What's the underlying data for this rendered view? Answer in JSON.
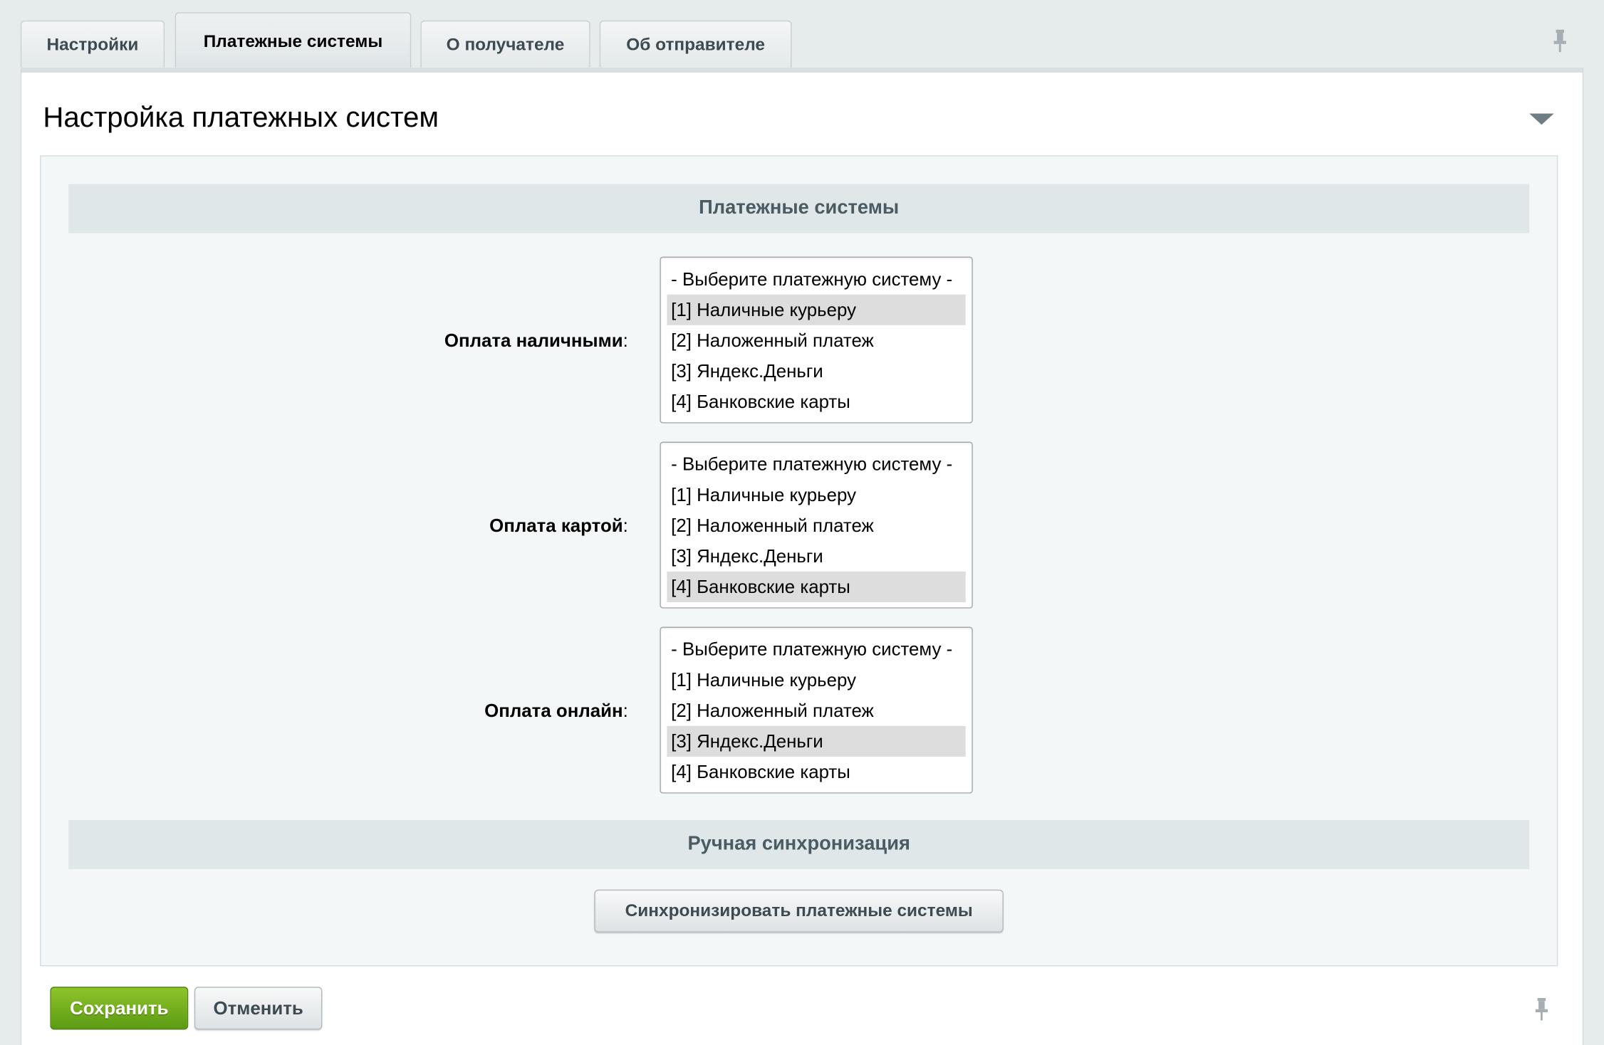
{
  "tabs": [
    {
      "label": "Настройки",
      "active": false
    },
    {
      "label": "Платежные системы",
      "active": true
    },
    {
      "label": "О получателе",
      "active": false
    },
    {
      "label": "Об отправителе",
      "active": false
    }
  ],
  "panel": {
    "title": "Настройка платежных систем"
  },
  "sections": {
    "payment_systems": "Платежные системы",
    "manual_sync": "Ручная синхронизация"
  },
  "options": [
    "- Выберите платежную систему -",
    "[1] Наличные курьеру",
    "[2] Наложенный платеж",
    "[3] Яндекс.Деньги",
    "[4] Банковские карты"
  ],
  "rows": [
    {
      "label": "Оплата наличными",
      "colon": ":",
      "selected_index": 1
    },
    {
      "label": "Оплата картой",
      "colon": ":",
      "selected_index": 4
    },
    {
      "label": "Оплата онлайн",
      "colon": ":",
      "selected_index": 3
    }
  ],
  "sync_button": "Синхронизировать платежные системы",
  "footer": {
    "save": "Сохранить",
    "cancel": "Отменить"
  },
  "colors": {
    "save_button": "#6aab1c",
    "section_header_bg": "#e0e7e8",
    "selected_option_bg": "#dddddd"
  }
}
